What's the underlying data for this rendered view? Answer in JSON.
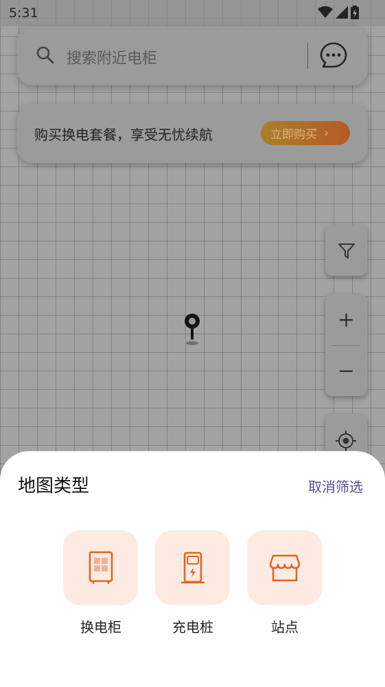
{
  "status_bar": {
    "time": "5:31"
  },
  "search": {
    "placeholder": "搜索附近电柜"
  },
  "promo": {
    "text": "购买换电套餐，享受无忧续航",
    "button_label": "立即购买"
  },
  "sheet": {
    "title": "地图类型",
    "cancel_label": "取消筛选",
    "options": [
      {
        "label": "换电柜",
        "icon": "battery-cabinet-icon"
      },
      {
        "label": "充电桩",
        "icon": "charging-pile-icon"
      },
      {
        "label": "站点",
        "icon": "store-icon"
      }
    ]
  },
  "colors": {
    "accent": "#e8601c",
    "option_bg": "#fdebe3",
    "link": "#5a4a96"
  }
}
